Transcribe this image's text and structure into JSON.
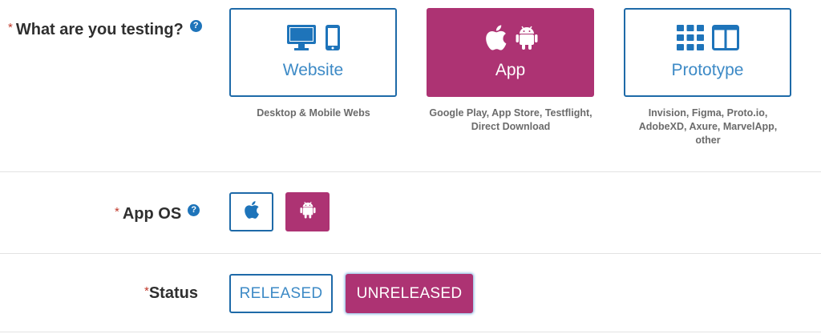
{
  "testing": {
    "required_mark": "*",
    "label": "What are you testing?",
    "help": "?",
    "options": [
      {
        "title": "Website",
        "subtitle_lines": [
          "Desktop & Mobile Webs"
        ],
        "icons": [
          "monitor-icon",
          "phone-icon"
        ],
        "selected": false
      },
      {
        "title": "App",
        "subtitle_lines": [
          "Google Play, App Store, Testflight,",
          "Direct Download"
        ],
        "icons": [
          "apple-icon",
          "android-icon"
        ],
        "selected": true
      },
      {
        "title": "Prototype",
        "subtitle_lines": [
          "Invision, Figma, Proto.io,",
          "AdobeXD, Axure, MarvelApp,",
          "other"
        ],
        "icons": [
          "grid-icon",
          "columns-icon"
        ],
        "selected": false
      }
    ]
  },
  "app_os": {
    "required_mark": "*",
    "label": "App OS",
    "help": "?",
    "options": [
      {
        "icon": "apple-icon",
        "selected": false
      },
      {
        "icon": "android-icon",
        "selected": true
      }
    ]
  },
  "status": {
    "required_mark": "*",
    "label": "Status",
    "options": [
      {
        "label": "RELEASED",
        "selected": false
      },
      {
        "label": "UNRELEASED",
        "selected": true
      }
    ]
  },
  "colors": {
    "blue": "#1e6aa8",
    "magenta": "#ad3373",
    "required": "#c0392b"
  }
}
